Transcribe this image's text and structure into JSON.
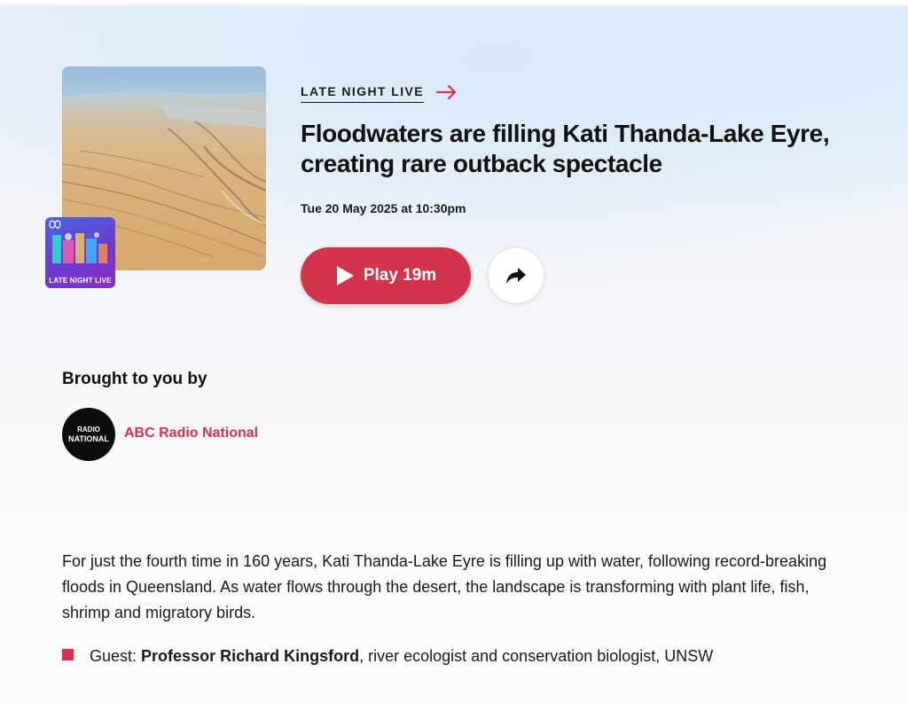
{
  "program": {
    "name": "LATE NIGHT LIVE",
    "badge_label": "LATE NIGHT LIVE"
  },
  "episode": {
    "title": "Floodwaters are filling Kati Thanda-Lake Eyre, creating rare outback spectacle",
    "datetime": "Tue 20 May 2025 at 10:30pm",
    "play_label": "Play 19m",
    "description": "For just the fourth time in 160 years, Kati Thanda-Lake Eyre is filling up with water, following record-breaking floods in Queensland. As water flows through the desert, the landscape is transforming with plant life, fish, shrimp and migratory birds."
  },
  "brought_to_you_by": {
    "heading": "Brought to you by",
    "network_name": "ABC Radio National",
    "logo_line1": "RADIO",
    "logo_line2": "NATIONAL"
  },
  "guest": {
    "prefix": "Guest:",
    "name": "Professor Richard Kingsford",
    "role": ", river ecologist and conservation biologist, UNSW"
  },
  "colors": {
    "accent": "#d4334c",
    "text": "#111111",
    "logo_bg": "#0d0d0d"
  },
  "icons": {
    "program_arrow": "arrow-right-icon",
    "play": "play-icon",
    "share": "share-icon",
    "abc_mark": "abc-logo-icon"
  }
}
